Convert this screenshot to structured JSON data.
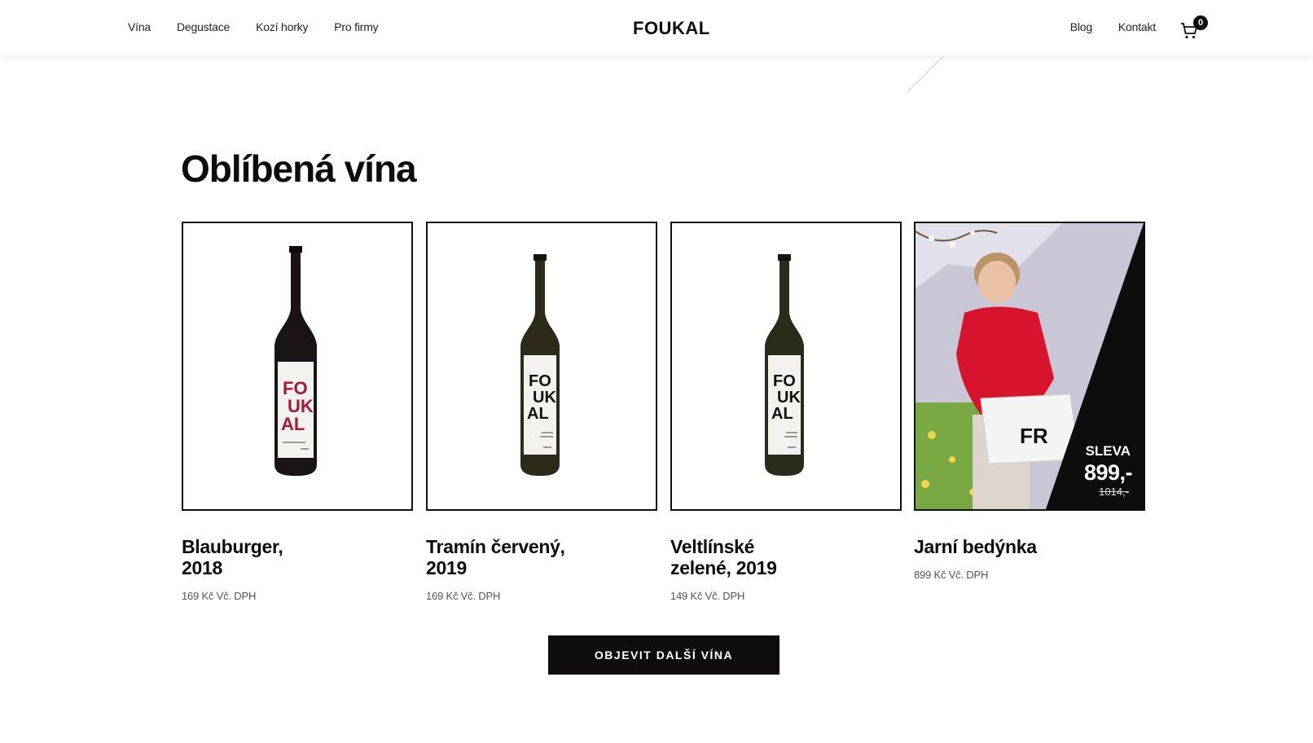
{
  "header": {
    "nav_left": [
      "Vína",
      "Degustace",
      "Kozí horky",
      "Pro firmy"
    ],
    "logo": "FOUKAL",
    "nav_right": [
      "Blog",
      "Kontakt"
    ],
    "cart_count": "0"
  },
  "main": {
    "title": "Oblíbená vína",
    "products": [
      {
        "name": "Blauburger,\n2018",
        "price": "169 Kč Vč. DPH",
        "bottle": "red-wine",
        "label_color": "#a31a3a"
      },
      {
        "name": "Tramín červený,\n2019",
        "price": "169 Kč Vč. DPH",
        "bottle": "white-wine",
        "label_color": "#111111"
      },
      {
        "name": "Veltlínské\nzelené, 2019",
        "price": "149 Kč Vč. DPH",
        "bottle": "white-wine",
        "label_color": "#111111"
      },
      {
        "name": "Jarní bedýnka",
        "price": "899 Kč Vč. DPH",
        "promo": {
          "label": "SLEVA",
          "price": "899,-",
          "old_price": "1014,-"
        }
      }
    ],
    "more_button": "OBJEVIT DALŠÍ VÍNA"
  },
  "colors": {
    "text": "#0f0c0c",
    "button_bg": "#0f0c0c",
    "red_label": "#a31a3a",
    "promo_shirt": "#d8132d"
  }
}
